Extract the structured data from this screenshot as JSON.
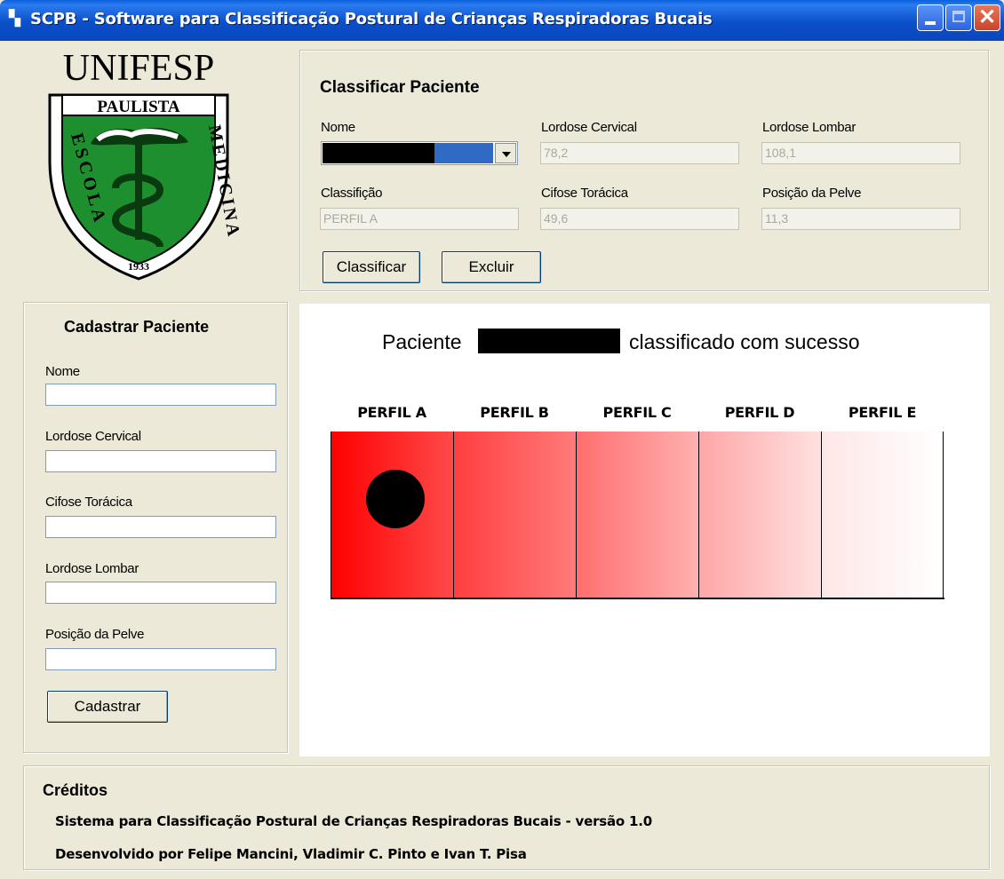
{
  "window": {
    "title": "SCPB - Software para Classificação Postural de Crianças Respiradoras Bucais",
    "icon": "app-window-icon",
    "controls": [
      "minimize-icon",
      "maximize-icon",
      "close-icon"
    ]
  },
  "logo": {
    "top_text": "UNIFESP",
    "banner_text": "PAULISTA",
    "left_arc": "ESCOLA",
    "right_arc": "MEDICINA",
    "year": "1933",
    "colors": {
      "shield_green": "#1E8F2E",
      "tree": "#0A3A10"
    }
  },
  "classify": {
    "title": "Classificar Paciente",
    "fields": {
      "nome_label": "Nome",
      "lordose_cervical_label": "Lordose Cervical",
      "lordose_cervical_value": "78,2",
      "lordose_lombar_label": "Lordose Lombar",
      "lordose_lombar_value": "108,1",
      "classificacao_label": "Classifição",
      "classificacao_value": "PERFIL A",
      "cifose_toracica_label": "Cifose Torácica",
      "cifose_toracica_value": "49,6",
      "posicao_pelve_label": "Posição da Pelve",
      "posicao_pelve_value": "11,3"
    },
    "buttons": {
      "classify": "Classificar",
      "delete": "Excluir"
    }
  },
  "register": {
    "title": "Cadastrar Paciente",
    "fields": {
      "nome": "Nome",
      "lordose_cervical": "Lordose Cervical",
      "cifose_toracica": "Cifose Torácica",
      "lordose_lombar": "Lordose Lombar",
      "posicao_pelve": "Posição da Pelve"
    },
    "button": "Cadastrar"
  },
  "result": {
    "message_prefix": "Paciente",
    "message_suffix": "classificado com sucesso",
    "profiles": [
      "PERFIL A",
      "PERFIL B",
      "PERFIL C",
      "PERFIL D",
      "PERFIL E"
    ],
    "selected_profile_index": 0,
    "gradient_colors": {
      "start": "#FF0000",
      "end": "#FFFFFF"
    }
  },
  "credits": {
    "title": "Créditos",
    "line1": "Sistema para Classificação Postural de Crianças Respiradoras Bucais - versão 1.0",
    "line2": "Desenvolvido por Felipe Mancini, Vladimir C. Pinto e Ivan T. Pisa"
  }
}
